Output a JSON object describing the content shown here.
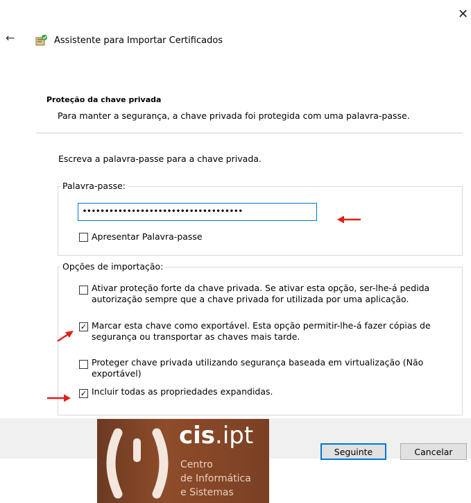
{
  "window": {
    "close_glyph": "✕",
    "back_glyph": "←",
    "title": "Assistente para Importar Certificados"
  },
  "section": {
    "heading": "Proteção da chave privada",
    "description": "Para manter a segurança, a chave privada foi protegida com uma palavra-passe."
  },
  "instruction": "Escreva a palavra-passe para a chave privada.",
  "password_group": {
    "label": "Palavra-passe:",
    "value": "••••••••••••••••••••••••••••••••••••",
    "show_password": {
      "label": "Apresentar Palavra-passe",
      "checked": false
    }
  },
  "options_group": {
    "label": "Opções de importação:",
    "options": [
      {
        "line1": "Ativar proteção forte da chave privada. Se ativar esta opção, ser-lhe-á pedida",
        "line2": "autorização sempre que a chave privada for utilizada por uma aplicação.",
        "checked": false
      },
      {
        "line1": "Marcar esta chave como exportável. Esta opção permitir-lhe-á fazer cópias de",
        "line2": "segurança ou transportar as chaves mais tarde.",
        "checked": true
      },
      {
        "line1": "Proteger chave privada utilizando segurança baseada em virtualização (Não",
        "line2": "exportável)",
        "checked": false
      },
      {
        "line1": "Incluir todas as propriedades expandidas.",
        "line2": "",
        "checked": true
      }
    ]
  },
  "buttons": {
    "next": "Seguinte",
    "cancel": "Cancelar"
  },
  "logo": {
    "brand_bold": "cis",
    "brand_rest": ".ipt",
    "line1": "Centro",
    "line2": "de Informática",
    "line3": "e Sistemas"
  },
  "colors": {
    "accent": "#0078d7",
    "annotation_arrow": "#e0201b",
    "logo_bg": "#8e4c2a"
  }
}
